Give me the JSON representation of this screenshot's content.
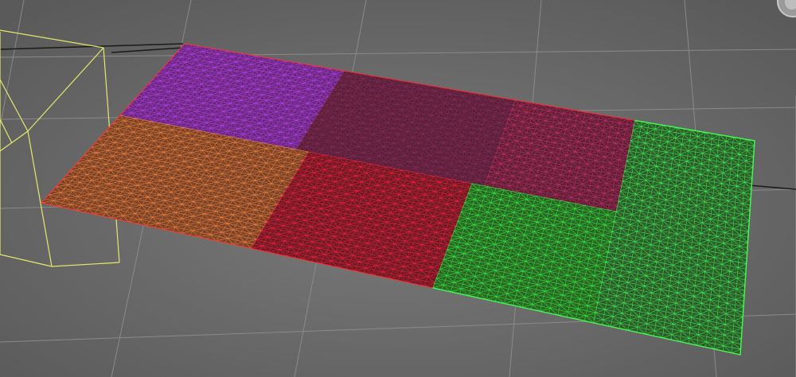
{
  "scene": {
    "background_color": "#6b6b6b",
    "grid_line_color": "#8a8a8a",
    "grid_axis_color": "#1a1a1a",
    "wire_box_color": "#e4e86a",
    "plane_edge_color": "#ff3030",
    "patch_colors": {
      "purple": "#c040ff",
      "orange": "#ff8a40",
      "maroon": "#8a2a5a",
      "crimson": "#ff2040",
      "pink": "#d03070",
      "green": "#30ff40",
      "lime": "#3cff55"
    },
    "icons": {
      "gizmo": "viewcube-gizmo-icon"
    }
  }
}
